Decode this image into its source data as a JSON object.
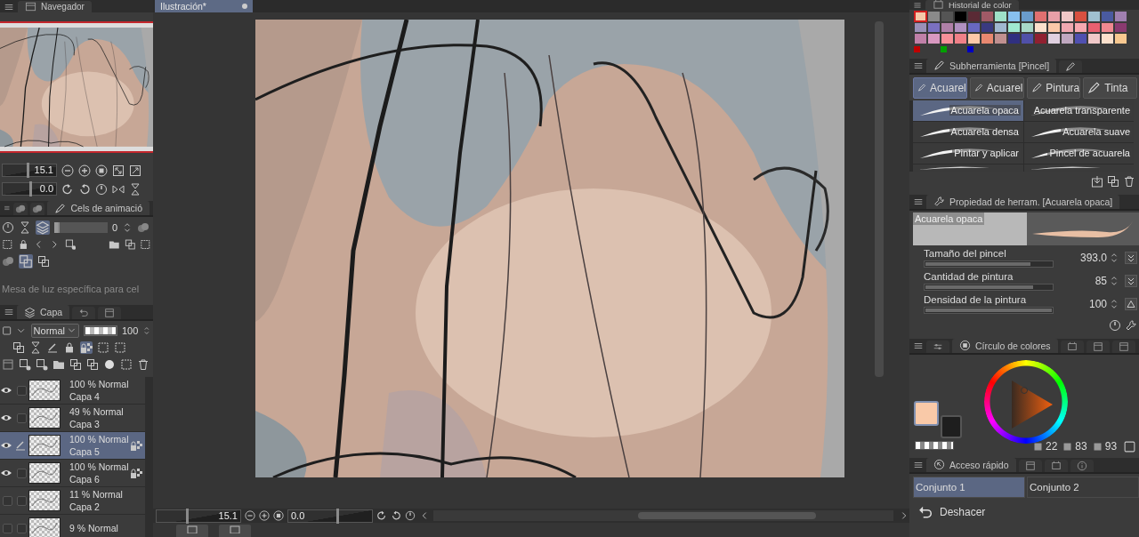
{
  "document_tab": {
    "title": "Ilustración*"
  },
  "navigator": {
    "title": "Navegador",
    "zoom": {
      "value": "15.1",
      "level": 0.45
    },
    "angle": {
      "value": "0.0",
      "level": 0.5
    }
  },
  "animation_cels": {
    "title": "Cels de animació",
    "frame": "0",
    "lightbox": "Mesa de luz específica para cel",
    "opacity_slider": {
      "level": 0.04
    }
  },
  "layers_panel": {
    "title": "Capa",
    "blend_mode": "Normal",
    "opacity": {
      "value": "100",
      "level": 1.0
    },
    "layers": [
      {
        "mode": "100 % Normal",
        "name": "Capa 4",
        "visible": true,
        "editing": false,
        "locked": false,
        "selected": false
      },
      {
        "mode": "49 % Normal",
        "name": "Capa 3",
        "visible": true,
        "editing": false,
        "locked": false,
        "selected": false
      },
      {
        "mode": "100 % Normal",
        "name": "Capa 5",
        "visible": true,
        "editing": true,
        "locked": true,
        "selected": true
      },
      {
        "mode": "100 % Normal",
        "name": "Capa 6",
        "visible": true,
        "editing": false,
        "locked": true,
        "selected": false
      },
      {
        "mode": "11 % Normal",
        "name": "Capa 2",
        "visible": false,
        "editing": false,
        "locked": false,
        "selected": false
      },
      {
        "mode": "9 % Normal",
        "visible": false,
        "editing": false,
        "locked": false,
        "selected": false
      }
    ]
  },
  "bottom_bar": {
    "zoom": {
      "value": "15.1",
      "level": 0.35
    },
    "angle": {
      "value": "0.0",
      "level": 0.57
    }
  },
  "color_history": {
    "title": "Historial de color",
    "swatches": [
      {
        "color": "#f6c9a9",
        "selected": true
      },
      {
        "color": "#8a8a8a",
        "selected": false
      },
      {
        "color": "#555555",
        "selected": false
      },
      {
        "color": "#000000",
        "selected": false
      },
      {
        "color": "#5a2a35",
        "selected": false
      },
      {
        "color": "#a05a66",
        "selected": false
      },
      {
        "color": "#9fe0c8",
        "selected": false
      },
      {
        "color": "#88c0ee",
        "selected": false
      },
      {
        "color": "#6a9ccc",
        "selected": false
      },
      {
        "color": "#e07070",
        "selected": false
      },
      {
        "color": "#e8a0a8",
        "selected": false
      },
      {
        "color": "#f0c8c8",
        "selected": false
      },
      {
        "color": "#d85040",
        "selected": false
      },
      {
        "color": "#a0c0d0",
        "selected": false
      },
      {
        "color": "#4a5aa0",
        "selected": false
      },
      {
        "color": "#a080b0",
        "selected": false
      },
      {
        "color": "#9a90b8",
        "selected": false
      },
      {
        "color": "#7a70c0",
        "selected": false
      },
      {
        "color": "#b080a8",
        "selected": false
      },
      {
        "color": "#b090c0",
        "selected": false
      },
      {
        "color": "#6868c0",
        "selected": false
      },
      {
        "color": "#3a3a80",
        "selected": false
      },
      {
        "color": "#a0b8d0",
        "selected": false
      },
      {
        "color": "#a0e8d0",
        "selected": false
      },
      {
        "color": "#a8d8c8",
        "selected": false
      },
      {
        "color": "#fce0cc",
        "selected": false
      },
      {
        "color": "#fbc8a8",
        "selected": false
      },
      {
        "color": "#f0a8b0",
        "selected": false
      },
      {
        "color": "#f8a8b0",
        "selected": false
      },
      {
        "color": "#e86070",
        "selected": false
      },
      {
        "color": "#f08890",
        "selected": false
      },
      {
        "color": "#8a3a70",
        "selected": false
      },
      {
        "color": "#c080a8",
        "selected": false
      },
      {
        "color": "#d898c0",
        "selected": false
      },
      {
        "color": "#f89098",
        "selected": false
      },
      {
        "color": "#f08088",
        "selected": false
      },
      {
        "color": "#fcc8a8",
        "selected": false
      },
      {
        "color": "#e88870",
        "selected": false
      },
      {
        "color": "#c09090",
        "selected": false
      },
      {
        "color": "#303080",
        "selected": false
      },
      {
        "color": "#5050a8",
        "selected": false
      },
      {
        "color": "#902030",
        "selected": false
      },
      {
        "color": "#e0d0e0",
        "selected": false
      },
      {
        "color": "#c0a8c0",
        "selected": false
      },
      {
        "color": "#5050b0",
        "selected": false
      },
      {
        "color": "#f0c8c8",
        "selected": false
      },
      {
        "color": "#fce0cc",
        "selected": false
      },
      {
        "color": "#f8c890",
        "selected": false
      }
    ],
    "recent": [
      {
        "color": "#c00000"
      },
      {
        "color": "#00a000"
      },
      {
        "color": "#0000c0"
      }
    ]
  },
  "subtool": {
    "title": "Subherramienta [Pincel]",
    "groups": [
      {
        "label": "Acuarel",
        "selected": true
      },
      {
        "label": "Acuarel",
        "selected": false
      },
      {
        "label": "Pintura",
        "selected": false
      },
      {
        "label": "Tinta",
        "selected": false
      }
    ],
    "brushes": [
      {
        "label": "Acuarela opaca",
        "selected": true
      },
      {
        "label": "Acuarela transparente",
        "selected": false
      },
      {
        "label": "Acuarela densa",
        "selected": false
      },
      {
        "label": "Acuarela suave",
        "selected": false
      },
      {
        "label": "Pintar y aplicar",
        "selected": false
      },
      {
        "label": "Pincel de acuarela",
        "selected": false
      }
    ]
  },
  "tool_property": {
    "title": "Propiedad de herram. [Acuarela opaca]",
    "preview_label": "Acuarela opaca",
    "properties": [
      {
        "label": "Tamaño del pincel",
        "value": "393.0",
        "level": 0.83
      },
      {
        "label": "Cantidad de pintura",
        "value": "85",
        "level": 0.85
      },
      {
        "label": "Densidad de la pintura",
        "value": "100",
        "level": 1.0
      }
    ]
  },
  "color_circle": {
    "title": "Círculo de colores",
    "colors": [
      {
        "kind": "main",
        "color": "#f9c9a8"
      },
      {
        "kind": "sub",
        "color": "#1e1e1e"
      }
    ],
    "h": "22",
    "s": "83",
    "v": "93"
  },
  "quick_access": {
    "title": "Acceso rápido",
    "sets": [
      {
        "label": "Conjunto 1",
        "selected": true
      },
      {
        "label": "Conjunto 2",
        "selected": false
      }
    ],
    "items": [
      "Deshacer"
    ]
  }
}
